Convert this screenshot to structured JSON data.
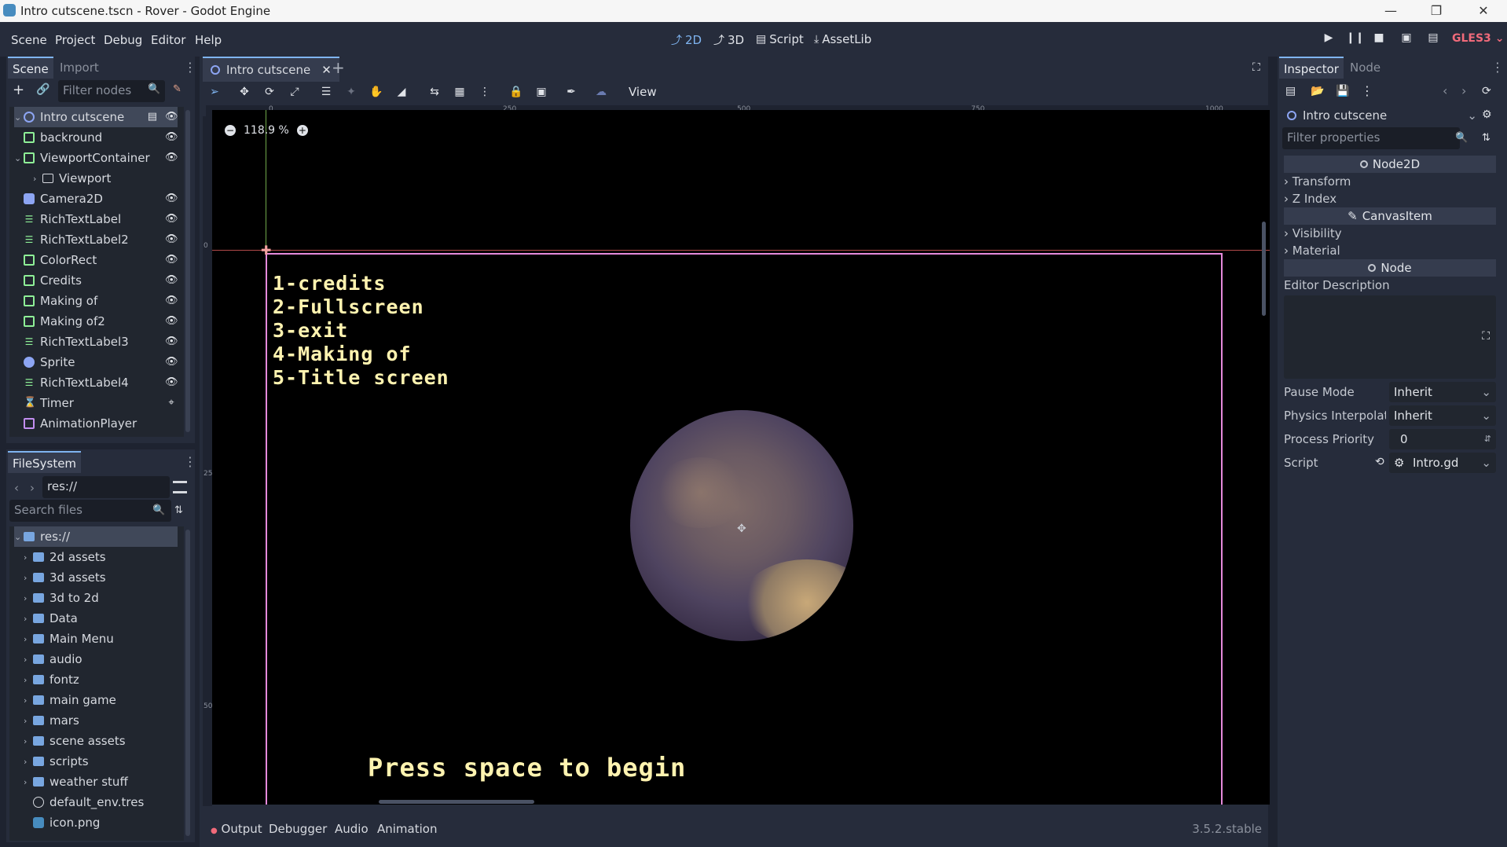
{
  "window": {
    "title": "Intro cutscene.tscn - Rover  - Godot Engine",
    "controls": [
      "minimize-icon",
      "maximize-icon",
      "close-icon"
    ]
  },
  "menubar": {
    "items": [
      "Scene",
      "Project",
      "Debug",
      "Editor",
      "Help"
    ],
    "workspaces": [
      {
        "label": "2D",
        "icon": "2d-icon",
        "active": true
      },
      {
        "label": "3D",
        "icon": "3d-icon",
        "active": false
      },
      {
        "label": "Script",
        "icon": "script-icon",
        "active": false
      },
      {
        "label": "AssetLib",
        "icon": "assetlib-icon",
        "active": false
      }
    ],
    "renderer": "GLES3"
  },
  "scene_dock": {
    "tabs": [
      "Scene",
      "Import"
    ],
    "filter_placeholder": "Filter nodes",
    "nodes": [
      {
        "label": "Intro cutscene",
        "icon": "node2d-icon",
        "depth": 0,
        "visible_toggle": true,
        "selected": true
      },
      {
        "label": "backround",
        "icon": "control-icon",
        "depth": 1,
        "visible_toggle": true
      },
      {
        "label": "ViewportContainer",
        "icon": "control-icon",
        "depth": 1,
        "visible_toggle": true,
        "expanded": true
      },
      {
        "label": "Viewport",
        "icon": "viewport-icon",
        "depth": 2,
        "visible_toggle": false,
        "collapsed": true
      },
      {
        "label": "Camera2D",
        "icon": "camera-icon",
        "depth": 1,
        "visible_toggle": true
      },
      {
        "label": "RichTextLabel",
        "icon": "richtext-icon",
        "depth": 1,
        "visible_toggle": true
      },
      {
        "label": "RichTextLabel2",
        "icon": "richtext-icon",
        "depth": 1,
        "visible_toggle": true
      },
      {
        "label": "ColorRect",
        "icon": "control-icon",
        "depth": 1,
        "visible_toggle": true
      },
      {
        "label": "Credits",
        "icon": "control-icon",
        "depth": 1,
        "visible_toggle": true
      },
      {
        "label": "Making of",
        "icon": "control-icon",
        "depth": 1,
        "visible_toggle": true
      },
      {
        "label": "Making of2",
        "icon": "control-icon",
        "depth": 1,
        "visible_toggle": true
      },
      {
        "label": "RichTextLabel3",
        "icon": "richtext-icon",
        "depth": 1,
        "visible_toggle": true
      },
      {
        "label": "Sprite",
        "icon": "sprite-icon",
        "depth": 1,
        "visible_toggle": true
      },
      {
        "label": "RichTextLabel4",
        "icon": "richtext-icon",
        "depth": 1,
        "visible_toggle": true
      },
      {
        "label": "Timer",
        "icon": "timer-icon",
        "depth": 1,
        "visible_toggle": false,
        "signal": true
      },
      {
        "label": "AnimationPlayer",
        "icon": "animation-player-icon",
        "depth": 1,
        "visible_toggle": false
      }
    ]
  },
  "filesystem": {
    "tab": "FileSystem",
    "path": "res://",
    "search_placeholder": "Search files",
    "items": [
      {
        "label": "res://",
        "type": "root"
      },
      {
        "label": "2d assets",
        "type": "folder"
      },
      {
        "label": "3d assets",
        "type": "folder"
      },
      {
        "label": "3d to 2d",
        "type": "folder"
      },
      {
        "label": "Data",
        "type": "folder"
      },
      {
        "label": "Main Menu",
        "type": "folder"
      },
      {
        "label": "audio",
        "type": "folder"
      },
      {
        "label": "fontz",
        "type": "folder"
      },
      {
        "label": "main game",
        "type": "folder"
      },
      {
        "label": "mars",
        "type": "folder"
      },
      {
        "label": "scene assets",
        "type": "folder"
      },
      {
        "label": "scripts",
        "type": "folder"
      },
      {
        "label": "weather stuff",
        "type": "folder"
      },
      {
        "label": "default_env.tres",
        "type": "file"
      },
      {
        "label": "icon.png",
        "type": "image"
      }
    ]
  },
  "editor": {
    "scene_tab": "Intro cutscene",
    "view_menu": "View",
    "zoom": "118.9 %",
    "ruler_ticks": [
      "0",
      "250",
      "500",
      "750",
      "1000"
    ],
    "vruler_ticks": [
      "0",
      "250",
      "500"
    ],
    "canvas": {
      "menu_lines": [
        "1-credits",
        "2-Fullscreen",
        "3-exit",
        "4-Making of",
        "5-Title screen"
      ],
      "prompt": "Press space to begin"
    }
  },
  "inspector": {
    "tabs": [
      "Inspector",
      "Node"
    ],
    "object": "Intro cutscene",
    "filter_placeholder": "Filter properties",
    "sections": {
      "node2d": "Node2D",
      "canvasitem": "CanvasItem",
      "node": "Node"
    },
    "groups": {
      "transform": "Transform",
      "zindex": "Z Index",
      "visibility": "Visibility",
      "material": "Material"
    },
    "editor_description": "Editor Description",
    "props": {
      "pause_mode": {
        "label": "Pause Mode",
        "value": "Inherit"
      },
      "physics": {
        "label": "Physics Interpolati",
        "value": "Inherit"
      },
      "priority": {
        "label": "Process Priority",
        "value": "0"
      },
      "script": {
        "label": "Script",
        "value": "Intro.gd"
      }
    }
  },
  "bottom_panel": {
    "tabs": [
      "Output",
      "Debugger",
      "Audio",
      "Animation"
    ],
    "version": "3.5.2.stable"
  },
  "colors": {
    "accent": "#7fb4f0",
    "bg_dark": "#1e2330",
    "panel": "#262c3b",
    "viewport_border": "#e58adb",
    "pixel_text": "#fff3b0",
    "gles": "#f06a7a"
  }
}
